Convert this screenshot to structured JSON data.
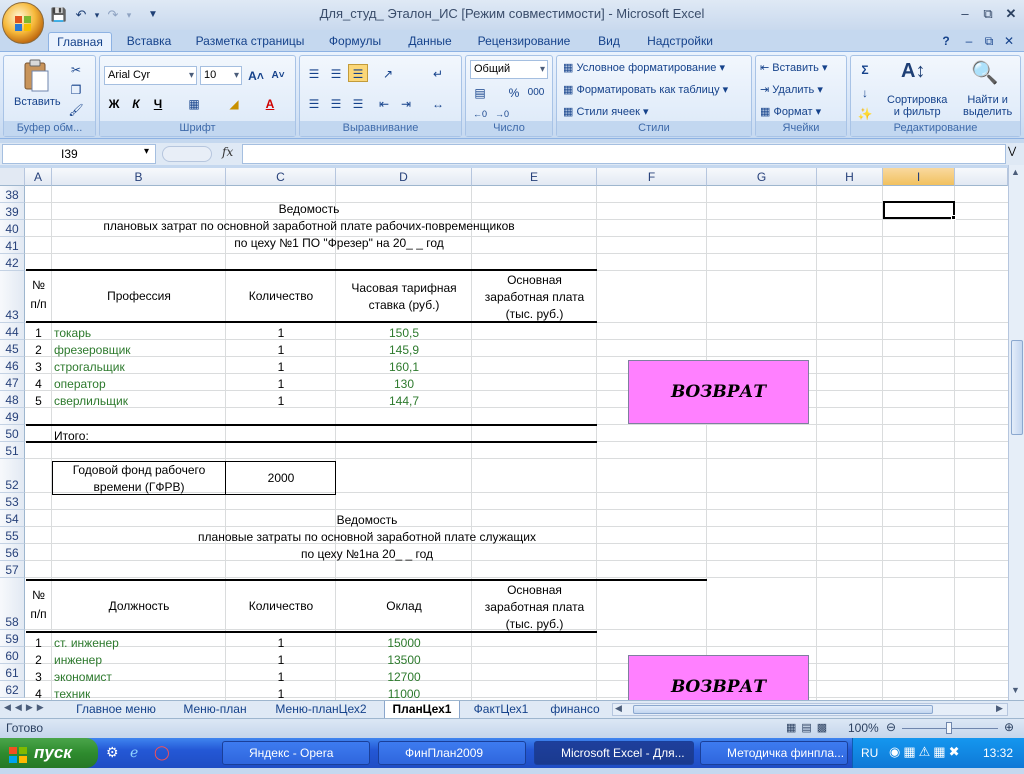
{
  "window": {
    "title": "Для_студ_ Эталон_ИС  [Режим совместимости] - Microsoft Excel"
  },
  "ribbon_tabs": [
    "Главная",
    "Вставка",
    "Разметка страницы",
    "Формулы",
    "Данные",
    "Рецензирование",
    "Вид",
    "Надстройки"
  ],
  "ribbon": {
    "clipboard": {
      "paste": "Вставить",
      "label": "Буфер обм..."
    },
    "font": {
      "name": "Arial Cyr",
      "size": "10",
      "bold": "Ж",
      "italic": "К",
      "underline": "Ч",
      "label": "Шрифт"
    },
    "alignment": {
      "label": "Выравнивание"
    },
    "number": {
      "format": "Общий",
      "label": "Число",
      "percent": "%",
      "thousands": "000"
    },
    "styles": {
      "conditional": "Условное форматирование",
      "as_table": "Форматировать как таблицу",
      "cell_styles": "Стили ячеек",
      "label": "Стили"
    },
    "cells": {
      "insert": "Вставить",
      "delete": "Удалить",
      "format": "Формат",
      "label": "Ячейки"
    },
    "editing": {
      "sort": "Сортировка",
      "sort2": "и фильтр",
      "find": "Найти и",
      "find2": "выделить",
      "label": "Редактирование"
    }
  },
  "formula_bar": {
    "name_box": "I39",
    "fx": "fx",
    "value": ""
  },
  "columns": [
    "A",
    "B",
    "C",
    "D",
    "E",
    "F",
    "G",
    "H",
    "I"
  ],
  "rows": [
    "38",
    "39",
    "40",
    "41",
    "42",
    "43",
    "44",
    "45",
    "46",
    "47",
    "48",
    "49",
    "50",
    "51",
    "52",
    "53",
    "54",
    "55",
    "56",
    "57",
    "58",
    "59",
    "60",
    "61",
    "62"
  ],
  "sheet": {
    "t1_title": "Ведомость",
    "t1_sub1": "плановых затрат по основной заработной плате рабочих-повременщиков",
    "t1_sub2": "по цеху №1 ПО \"Фрезер\" на 20_ _ год",
    "t1_headers": {
      "num": "№",
      "num2": "п/п",
      "prof": "Профессия",
      "qty": "Количество",
      "rate1": "Часовая тарифная",
      "rate2": "ставка (руб.)",
      "sal1": "Основная",
      "sal2": "заработная плата",
      "sal3": "(тыс. руб.)"
    },
    "t1_rows": [
      {
        "n": "1",
        "name": "токарь",
        "qty": "1",
        "rate": "150,5"
      },
      {
        "n": "2",
        "name": "фрезеровщик",
        "qty": "1",
        "rate": "145,9"
      },
      {
        "n": "3",
        "name": "строгальщик",
        "qty": "1",
        "rate": "160,1"
      },
      {
        "n": "4",
        "name": "оператор",
        "qty": "1",
        "rate": "130"
      },
      {
        "n": "5",
        "name": "сверлильщик",
        "qty": "1",
        "rate": "144,7"
      }
    ],
    "t1_total": "Итого:",
    "gfrv_label1": "Годовой фонд рабочего",
    "gfrv_label2": "времени (ГФРВ)",
    "gfrv_value": "2000",
    "t2_title": "Ведомость",
    "t2_sub1": "плановые затраты по основной заработной плате служащих",
    "t2_sub2": "по цеху №1на 20_ _ год",
    "t2_headers": {
      "num": "№",
      "num2": "п/п",
      "pos": "Должность",
      "qty": "Количество",
      "salary": "Оклад",
      "sal1": "Основная",
      "sal2": "заработная плата",
      "sal3": "(тыс. руб.)"
    },
    "t2_rows": [
      {
        "n": "1",
        "name": "ст. инженер",
        "qty": "1",
        "rate": "15000"
      },
      {
        "n": "2",
        "name": "инженер",
        "qty": "1",
        "rate": "13500"
      },
      {
        "n": "3",
        "name": "экономист",
        "qty": "1",
        "rate": "12700"
      },
      {
        "n": "4",
        "name": "техник",
        "qty": "1",
        "rate": "11000"
      }
    ],
    "return_button": "ВОЗВРАТ"
  },
  "sheet_tabs": [
    "Главное меню",
    "Меню-план",
    "Меню-планЦех2",
    "ПланЦех1",
    "ФактЦех1",
    "финансо"
  ],
  "active_sheet": "ПланЦех1",
  "status": {
    "ready": "Готово",
    "zoom": "100%"
  },
  "taskbar": {
    "start": "пуск",
    "tasks": [
      "Яндекс - Opera",
      "ФинПлан2009",
      "Microsoft Excel - Для...",
      "Методичка финпла..."
    ],
    "lang": "RU",
    "clock": "13:32"
  }
}
